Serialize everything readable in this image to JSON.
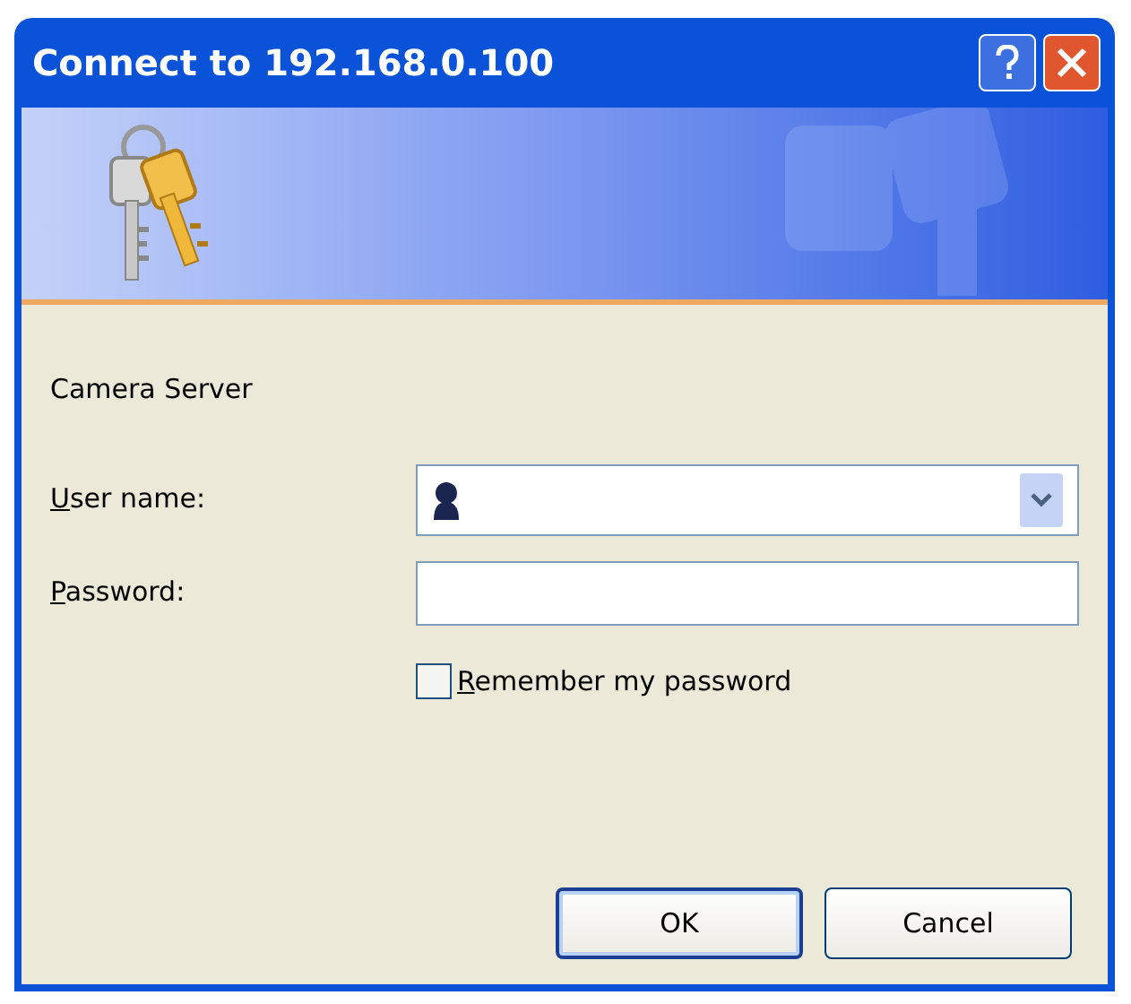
{
  "window": {
    "title": "Connect to 192.168.0.100"
  },
  "realm": "Camera Server",
  "username": {
    "label": "User name:"
  },
  "password": {
    "label": "Password:"
  },
  "remember": {
    "label": "Remember my password",
    "checked": false
  },
  "buttons": [
    {
      "label": "OK",
      "kind": "default"
    },
    {
      "label": "Cancel",
      "kind": "normal"
    }
  ]
}
